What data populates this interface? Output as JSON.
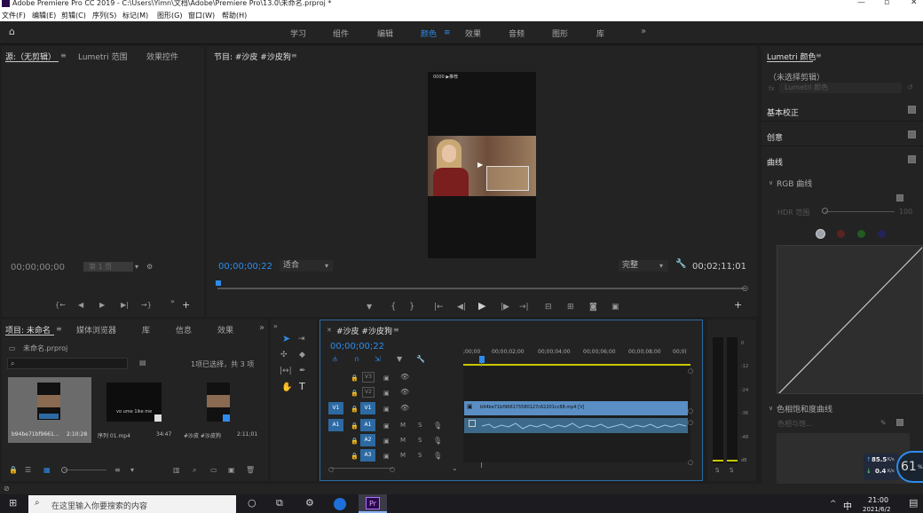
{
  "window": {
    "title": "Adobe Premiere Pro CC 2019 - C:\\Users\\Yimn\\文档\\Adobe\\Premiere Pro\\13.0\\未命名.prproj *"
  },
  "menu": {
    "items": [
      "文件(F)",
      "编辑(E)",
      "剪辑(C)",
      "序列(S)",
      "标记(M)",
      "图形(G)",
      "窗口(W)",
      "帮助(H)"
    ]
  },
  "workspaces": {
    "items": [
      "学习",
      "组件",
      "编辑",
      "颜色",
      "效果",
      "音频",
      "图形",
      "库"
    ],
    "active": "颜色"
  },
  "source_panel": {
    "tabs": [
      "源:（无剪辑）",
      "Lumetri 范围",
      "效果控件"
    ],
    "timecode": "00;00;00;00",
    "page": "第 1 页"
  },
  "program_monitor": {
    "title": "节目: #沙皮 #沙皮狗",
    "timecode": "00;00;00;22",
    "fit": "适合",
    "quality": "完整",
    "duration": "00;02;11;01",
    "video_top_text": "0000 ▶推荐"
  },
  "lumetri": {
    "title": "Lumetri 颜色",
    "clip": "（未选择剪辑）",
    "fx_placeholder": "Lumetri 颜色",
    "sections": [
      "基本校正",
      "创意",
      "曲线"
    ],
    "rgb_curves": "RGB 曲线",
    "hdr_label": "HDR 范围",
    "hdr_value": "100",
    "hsl_curves": "色相饱和度曲线",
    "hsl_sub": "色相与饱..."
  },
  "project_panel": {
    "tabs": [
      "项目: 未命名",
      "媒体浏览器",
      "库",
      "信息",
      "效果"
    ],
    "file": "未命名.prproj",
    "selection": "1项已选择，共 3 项",
    "items": [
      {
        "name": "b94be71bf9661...",
        "duration": "2:10:28"
      },
      {
        "name": "序列 01.mp4",
        "duration": "34:47"
      },
      {
        "name": "#沙皮 #沙皮狗",
        "duration": "2:11;01"
      }
    ],
    "thumb2_text": "vo ume 1ike me"
  },
  "timeline": {
    "tab": "#沙皮 #沙皮狗",
    "timecode": "00;00;00;22",
    "ruler": [
      ";00;00",
      "00;00;02;00",
      "00;00;04;00",
      "00;00;06;00",
      "00;00;08;00",
      "00;0("
    ],
    "video_tracks": [
      "V3",
      "V2",
      "V1"
    ],
    "audio_tracks": [
      "A1",
      "A2",
      "A3"
    ],
    "clip_label": "b94be71bf966175580127c62201cc88.mp4 [V]",
    "src_v": "V1",
    "src_a": "A1",
    "m_label": "M",
    "s_label": "S"
  },
  "meter": {
    "labels": [
      "0",
      "-12",
      "-24",
      "-36",
      "-48",
      "dB"
    ],
    "solo": [
      "S",
      "S"
    ]
  },
  "network": {
    "up": "85.5",
    "up_unit": "K/s",
    "down": "0.4",
    "down_unit": "K/s",
    "percent": "61",
    "percent_sign": "%"
  },
  "taskbar": {
    "search": "在这里输入你要搜索的内容",
    "time": "21:00",
    "date": "2021/6/2",
    "ime": "中",
    "app_label": "Pr"
  },
  "colors": {
    "accent": "#2d8ceb",
    "panel": "#232323",
    "background": "#1e1e1e",
    "track_button": "#2d6aa3",
    "clip": "#5a8ec4",
    "audio_clip": "#3d6a8a"
  }
}
